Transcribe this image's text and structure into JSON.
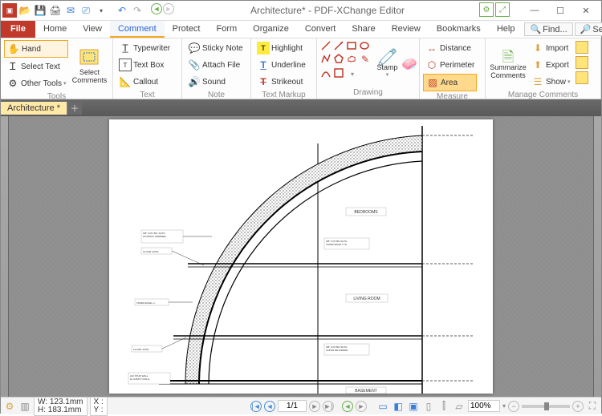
{
  "title": "Architecture* - PDF-XChange Editor",
  "menu": {
    "file": "File",
    "home": "Home",
    "view": "View",
    "comment": "Comment",
    "protect": "Protect",
    "form": "Form",
    "organize": "Organize",
    "convert": "Convert",
    "share": "Share",
    "review": "Review",
    "bookmarks": "Bookmarks",
    "help": "Help"
  },
  "find": "Find...",
  "search": "Search...",
  "ribbon": {
    "tools": {
      "hand": "Hand",
      "select_text": "Select Text",
      "other_tools": "Other Tools",
      "select_comments": "Select\nComments",
      "group": "Tools"
    },
    "text": {
      "typewriter": "Typewriter",
      "textbox": "Text Box",
      "callout": "Callout",
      "group": "Text"
    },
    "note": {
      "sticky": "Sticky Note",
      "attach": "Attach File",
      "sound": "Sound",
      "group": "Note"
    },
    "markup": {
      "highlight": "Highlight",
      "underline": "Underline",
      "strikeout": "Strikeout",
      "group": "Text Markup"
    },
    "drawing": {
      "stamp": "Stamp",
      "group": "Drawing"
    },
    "measure": {
      "distance": "Distance",
      "perimeter": "Perimeter",
      "area": "Area",
      "group": "Measure"
    },
    "manage": {
      "summarize": "Summarize\nComments",
      "import": "Import",
      "export": "Export",
      "show": "Show",
      "group": "Manage Comments"
    }
  },
  "doctab": "Architecture *",
  "plan": {
    "bedrooms": "BEDROOMS",
    "living": "LIVING ROOM",
    "basement": "BASEMENT",
    "note1": "5/8\" GYPSUM SHEATHING\nW/MOISTURE B. R-20 MAX",
    "note2": "TAPER EDGE +/-",
    "note3": "FLOOR JOIST",
    "note4": "2x6 STUD WALL PER RES.\nW/ R-19 BATT INSULATION\nVAPOR RETARDER"
  },
  "status": {
    "w": "W: 123.1mm",
    "h": "H: 183.1mm",
    "x": "X :",
    "y": "Y :",
    "page": "1/1",
    "zoom": "100%"
  }
}
